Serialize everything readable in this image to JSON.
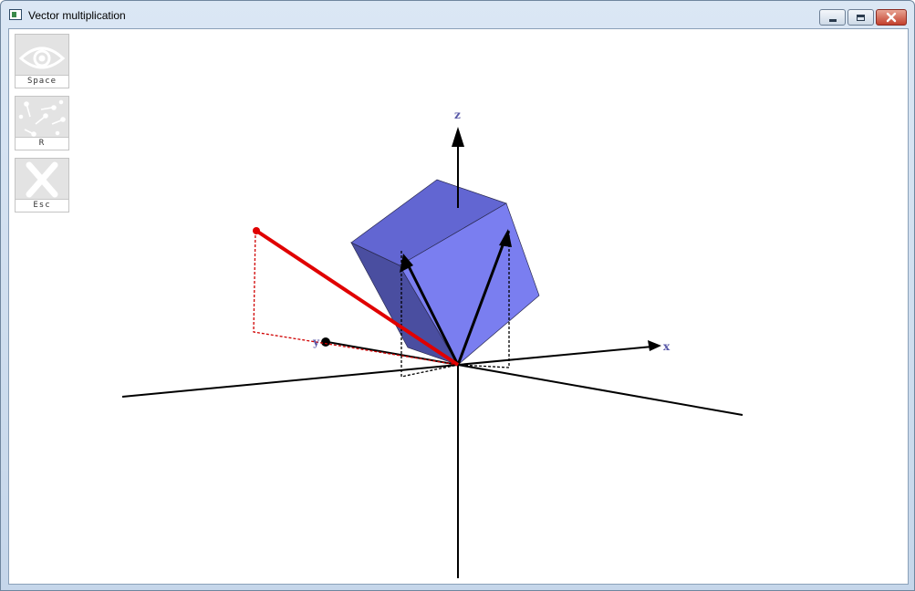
{
  "window": {
    "title": "Vector multiplication"
  },
  "toolbar": {
    "buttons": [
      {
        "label": "Space",
        "icon": "eye-icon"
      },
      {
        "label": "R",
        "icon": "vectors-icon"
      },
      {
        "label": "Esc",
        "icon": "close-x-icon"
      }
    ]
  },
  "scene": {
    "axes": {
      "x": "x",
      "y": "y",
      "z": "z"
    },
    "colors": {
      "parallelepiped_front": "#7a7ef0",
      "parallelepiped_side": "#4a4ea0",
      "parallelepiped_top": "#6266d2",
      "cross_product_vector": "#e00000",
      "axis": "#000000"
    }
  }
}
